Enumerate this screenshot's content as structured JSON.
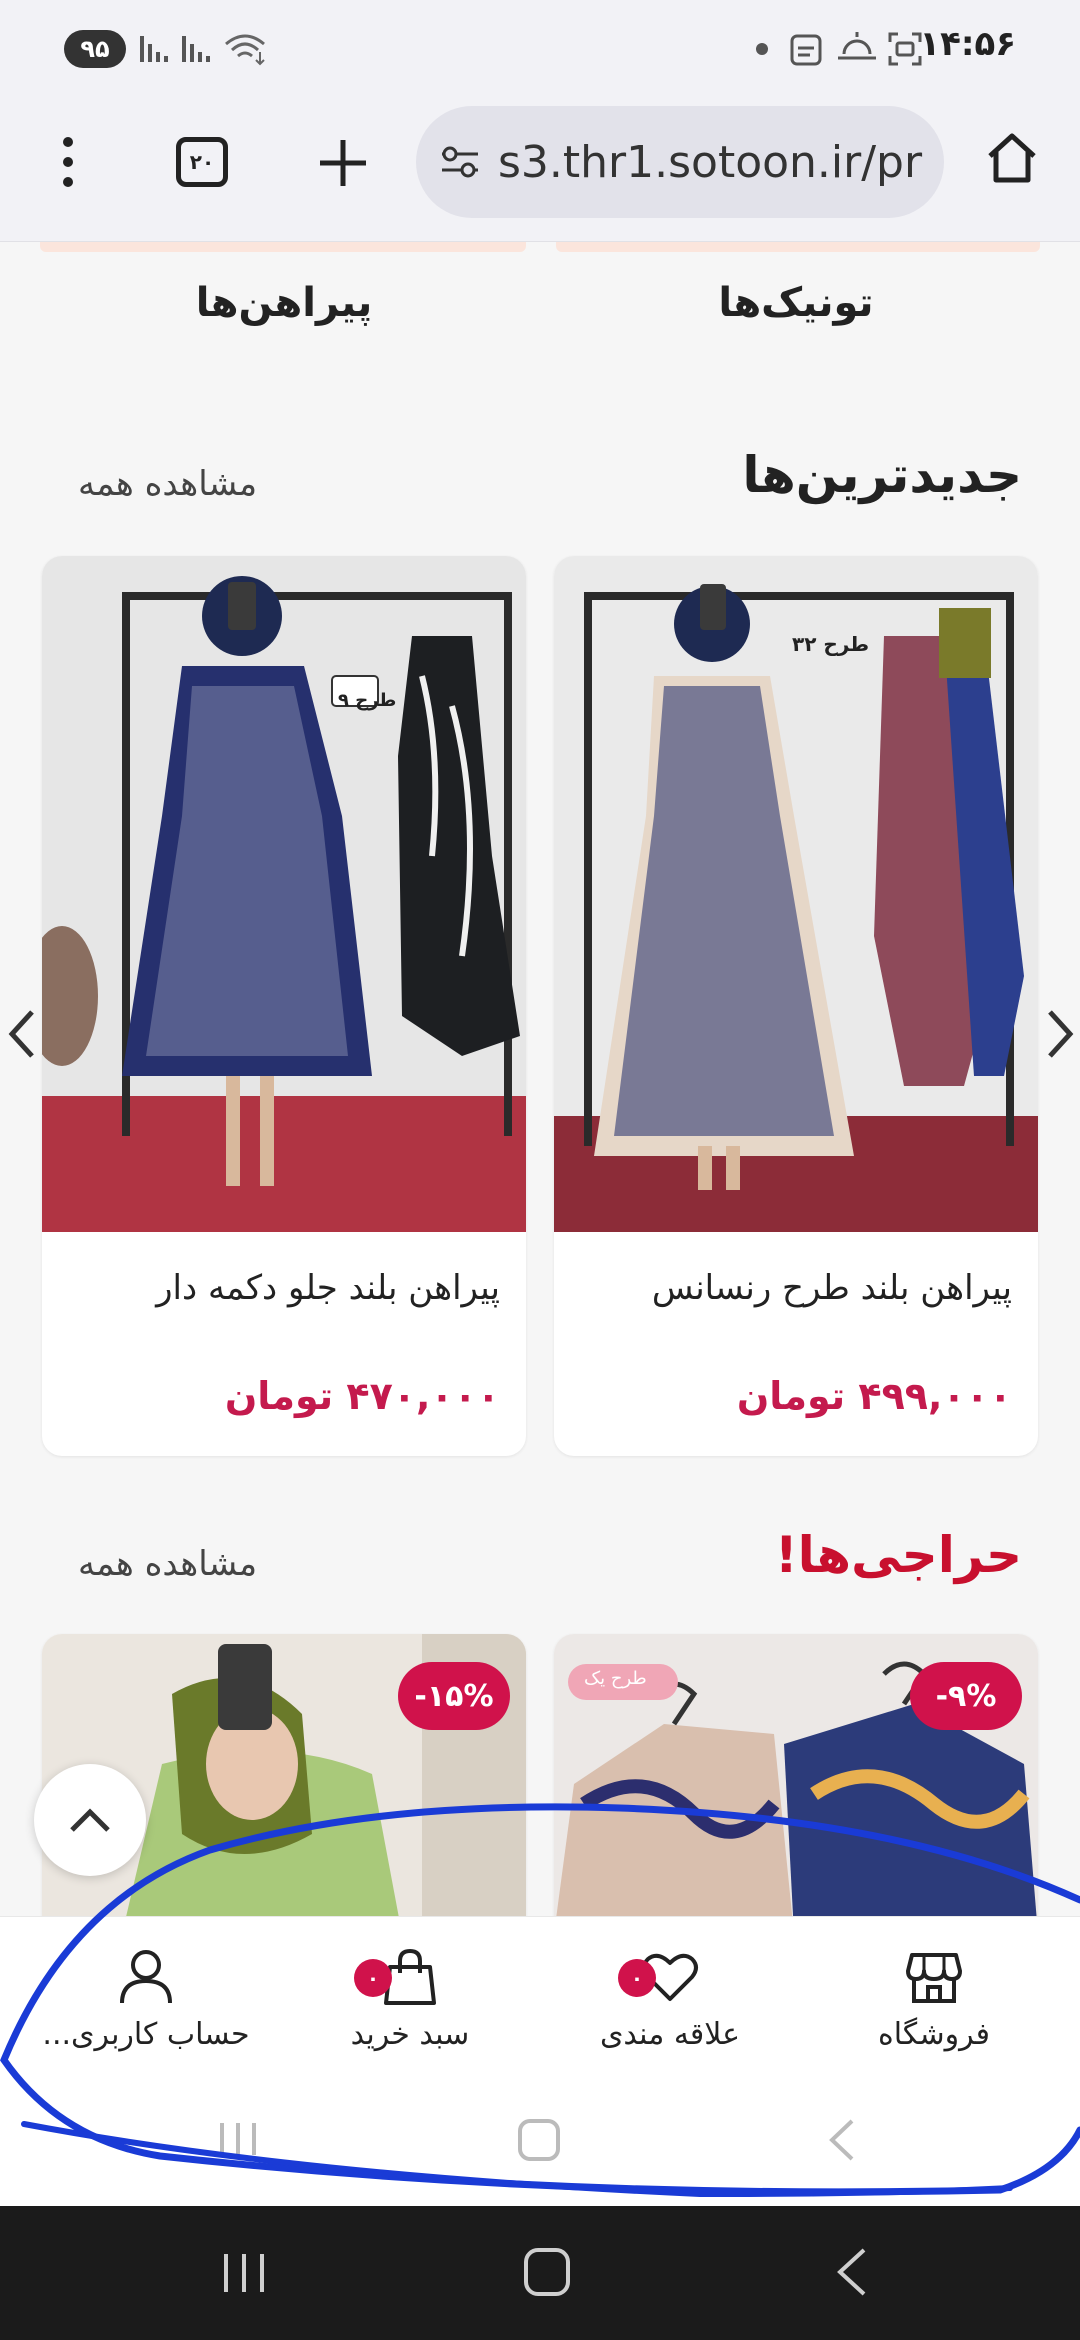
{
  "status_bar": {
    "time": "۱۴:۵۶",
    "battery": "۹۵"
  },
  "browser": {
    "url": "s3.thr1.sotoon.ir/pr",
    "tab_count": "۲۰",
    "icons": [
      "home-icon",
      "site-settings-icon",
      "new-tab-icon",
      "tabs-icon",
      "menu-icon"
    ]
  },
  "categories": [
    {
      "label": "تونیک‌ها"
    },
    {
      "label": "پیراهن‌ها"
    }
  ],
  "newest": {
    "title": "جدیدترین‌ها",
    "see_all": "مشاهده همه",
    "products": [
      {
        "name": "پیراهن بلند طرح رنسانس",
        "price": "۴۹۹,۰۰۰ تومان",
        "tag": "طرح ۳۲"
      },
      {
        "name": "پیراهن بلند جلو دکمه دار",
        "price": "۴۷۰,۰۰۰ تومان",
        "tag": "طرح ۹"
      }
    ]
  },
  "sales": {
    "title": "حراجی‌ها!",
    "see_all": "مشاهده همه",
    "products": [
      {
        "discount": "-۹%",
        "tag": "طرح یک"
      },
      {
        "discount": "-۱۵%"
      }
    ]
  },
  "bottom_nav": {
    "items": [
      {
        "label": "فروشگاه",
        "icon": "store-icon"
      },
      {
        "label": "علاقه مندی",
        "icon": "heart-icon",
        "count": "۰"
      },
      {
        "label": "سبد خرید",
        "icon": "shopping-bag-icon",
        "count": "۰"
      },
      {
        "label": "حساب کاربری...",
        "icon": "user-icon"
      }
    ]
  },
  "colors": {
    "accent": "#c41a4d",
    "sale_title": "#c8102e",
    "badge": "#d0124b",
    "annotation_stroke": "#1a3bd6"
  }
}
